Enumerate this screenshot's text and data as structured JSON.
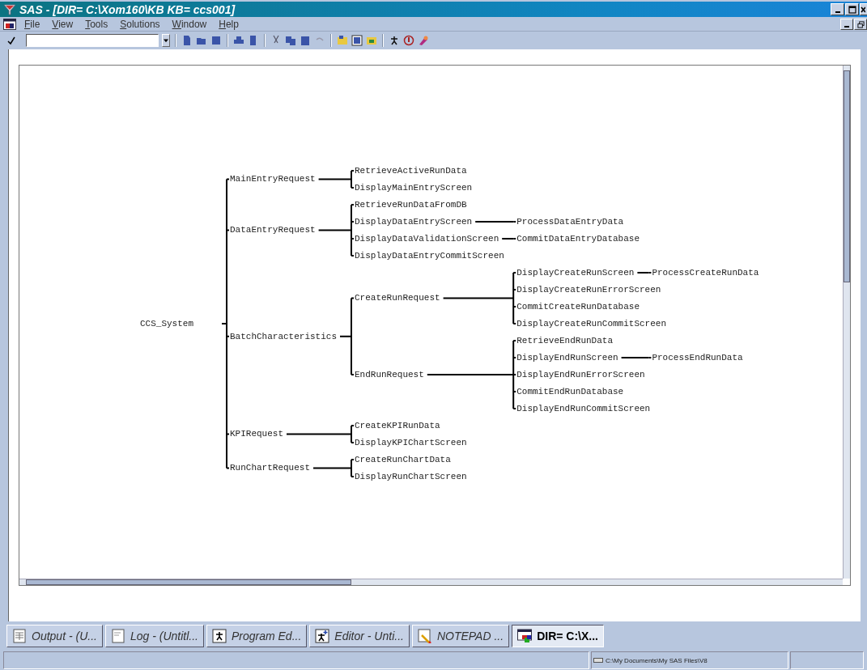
{
  "window": {
    "title": "SAS - [DIR= C:\\Xom160\\KB  KB= ccs001]"
  },
  "menu": [
    "File",
    "View",
    "Tools",
    "Solutions",
    "Window",
    "Help"
  ],
  "tree": {
    "label": "CCS_System",
    "children": [
      {
        "label": "MainEntryRequest",
        "children": [
          {
            "label": "RetrieveActiveRunData"
          },
          {
            "label": "DisplayMainEntryScreen"
          }
        ]
      },
      {
        "label": "DataEntryRequest",
        "children": [
          {
            "label": "RetrieveRunDataFromDB"
          },
          {
            "label": "DisplayDataEntryScreen",
            "children": [
              {
                "label": "ProcessDataEntryData"
              }
            ]
          },
          {
            "label": "DisplayDataValidationScreen",
            "children": [
              {
                "label": "CommitDataEntryDatabase"
              }
            ]
          },
          {
            "label": "DisplayDataEntryCommitScreen"
          }
        ]
      },
      {
        "label": "BatchCharacteristics",
        "children": [
          {
            "label": "CreateRunRequest",
            "children": [
              {
                "label": "DisplayCreateRunScreen",
                "children": [
                  {
                    "label": "ProcessCreateRunData"
                  }
                ]
              },
              {
                "label": "DisplayCreateRunErrorScreen"
              },
              {
                "label": "CommitCreateRunDatabase"
              },
              {
                "label": "DisplayCreateRunCommitScreen"
              }
            ]
          },
          {
            "label": "EndRunRequest",
            "children": [
              {
                "label": "RetrieveEndRunData"
              },
              {
                "label": "DisplayEndRunScreen",
                "children": [
                  {
                    "label": "ProcessEndRunData"
                  }
                ]
              },
              {
                "label": "DisplayEndRunErrorScreen"
              },
              {
                "label": "CommitEndRunDatabase"
              },
              {
                "label": "DisplayEndRunCommitScreen"
              }
            ]
          }
        ]
      },
      {
        "label": "KPIRequest",
        "children": [
          {
            "label": "CreateKPIRunData"
          },
          {
            "label": "DisplayKPIChartScreen"
          }
        ]
      },
      {
        "label": "RunChartRequest",
        "children": [
          {
            "label": "CreateRunChartData"
          },
          {
            "label": "DisplayRunChartScreen"
          }
        ]
      }
    ]
  },
  "task_tabs": [
    {
      "label": "Output - (U...",
      "selected": false
    },
    {
      "label": "Log - (Untitl...",
      "selected": false
    },
    {
      "label": "Program Ed...",
      "selected": false
    },
    {
      "label": "Editor - Unti...",
      "selected": false
    },
    {
      "label": "NOTEPAD ...",
      "selected": false
    },
    {
      "label": "DIR= C:\\X...",
      "selected": true
    }
  ],
  "status_bar": {
    "path": "C:\\My Documents\\My SAS Files\\V8"
  }
}
